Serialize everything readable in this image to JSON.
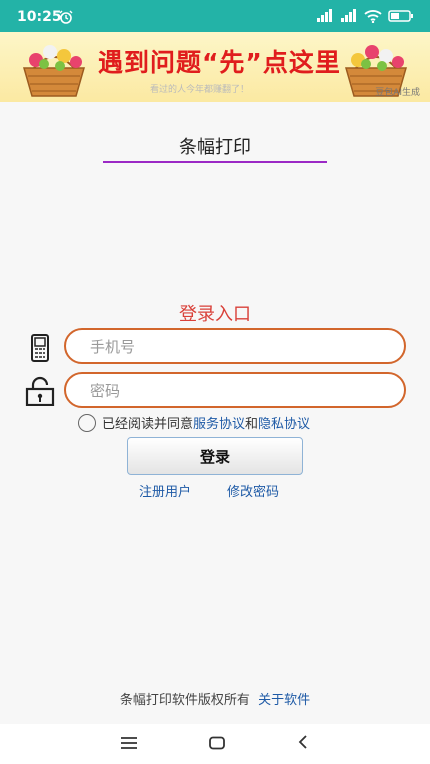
{
  "status_bar": {
    "time": "10:25",
    "icons": [
      "alarm-icon",
      "signal-icon",
      "signal-icon",
      "wifi-icon",
      "battery-icon"
    ]
  },
  "banner": {
    "title": "遇到问题“先”点这里",
    "subtitle": "看过的人今年都赚翻了！",
    "ai_tag": "豆包AI生成"
  },
  "app": {
    "title": "条幅打印"
  },
  "login": {
    "title": "登录入口",
    "phone_placeholder": "手机号",
    "password_placeholder": "密码",
    "agree_prefix": "已经阅读并同意",
    "service_agreement": "服务协议",
    "and": "和",
    "privacy_agreement": "隐私协议",
    "login_button": "登录",
    "register_link": "注册用户",
    "change_password_link": "修改密码"
  },
  "footer": {
    "copyright": "条幅打印软件版权所有",
    "about": "关于软件"
  },
  "colors": {
    "status_bar": "#23b3a7",
    "field_border": "#d2662c",
    "login_title": "#d9413a",
    "link": "#1e5aa6",
    "underline": "#9b29c5"
  }
}
